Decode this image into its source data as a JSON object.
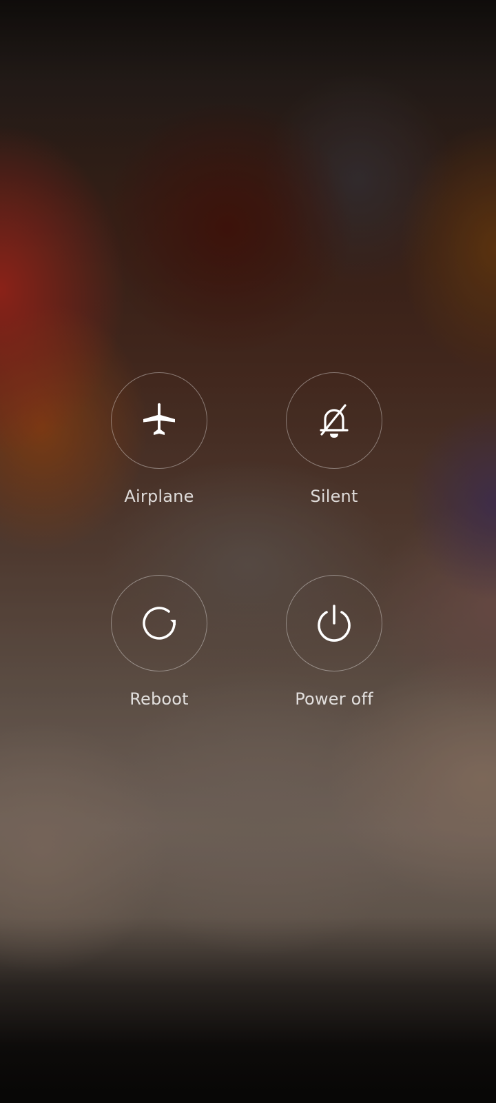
{
  "power_menu": {
    "actions": [
      {
        "id": "airplane",
        "label": "Airplane",
        "icon": "airplane-icon"
      },
      {
        "id": "silent",
        "label": "Silent",
        "icon": "bell-off-icon"
      },
      {
        "id": "reboot",
        "label": "Reboot",
        "icon": "reboot-icon"
      },
      {
        "id": "power_off",
        "label": "Power off",
        "icon": "power-icon"
      }
    ],
    "colors": {
      "circle_border": "#ffffff61",
      "label_text": "#ffffffd1",
      "icon": "#ffffff"
    }
  }
}
